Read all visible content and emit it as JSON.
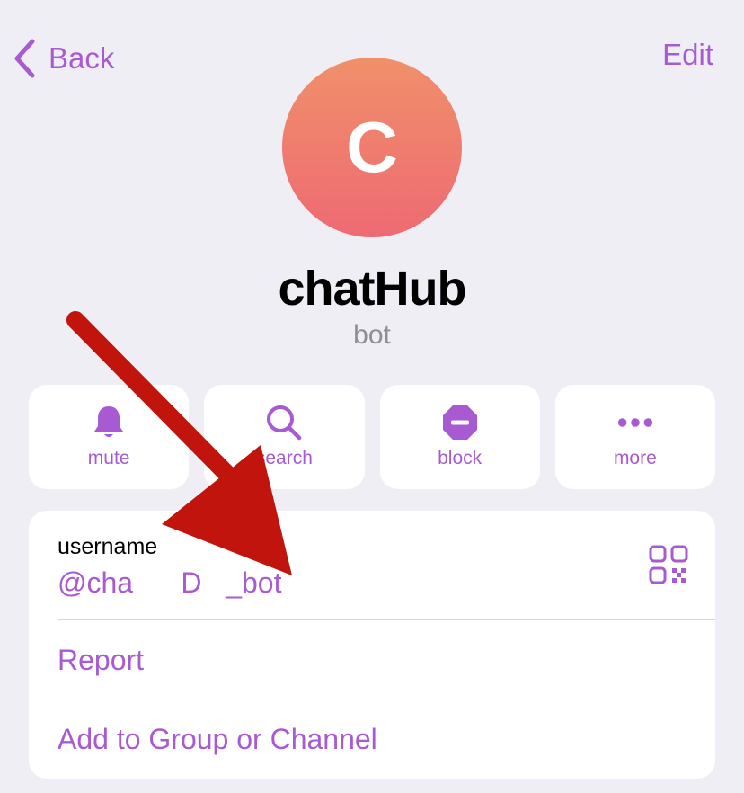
{
  "nav": {
    "back_label": "Back",
    "edit_label": "Edit"
  },
  "profile": {
    "avatar_letter": "C",
    "name": "chatHub",
    "subtitle": "bot"
  },
  "actions": [
    {
      "label": "mute",
      "icon": "bell-icon"
    },
    {
      "label": "search",
      "icon": "search-icon"
    },
    {
      "label": "block",
      "icon": "block-icon"
    },
    {
      "label": "more",
      "icon": "more-icon"
    }
  ],
  "info": {
    "username_label": "username",
    "username_value": "@cha      D   _bot",
    "report_label": "Report",
    "add_label": "Add to Group or Channel"
  },
  "colors": {
    "accent": "#a85ad3",
    "background": "#efeef4",
    "annotation_arrow": "#c0140c"
  }
}
